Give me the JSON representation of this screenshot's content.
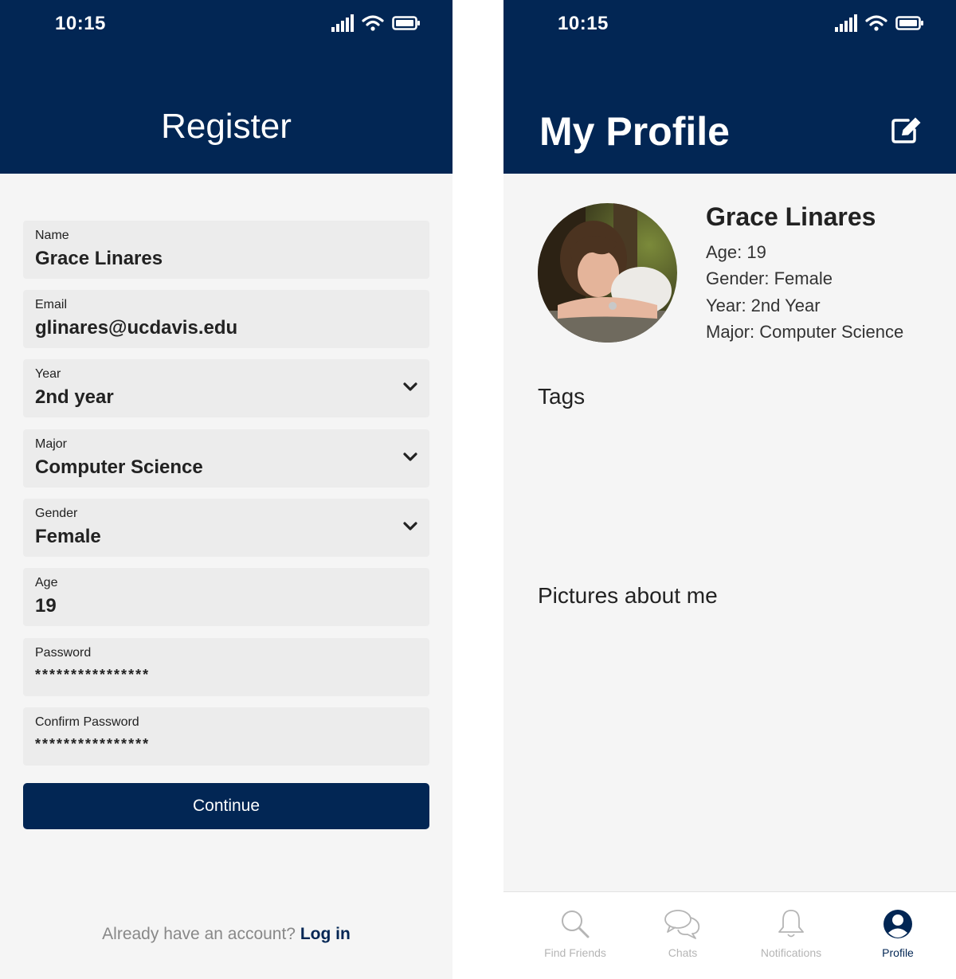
{
  "register": {
    "status_time": "10:15",
    "title": "Register",
    "fields": [
      {
        "label": "Name",
        "value": "Grace Linares"
      },
      {
        "label": "Email",
        "value": "glinares@ucdavis.edu"
      },
      {
        "label": "Year",
        "value": "2nd year"
      },
      {
        "label": "Major",
        "value": "Computer Science"
      },
      {
        "label": "Gender",
        "value": "Female"
      },
      {
        "label": "Age",
        "value": "19"
      },
      {
        "label": "Password",
        "value": "****************"
      },
      {
        "label": "Confirm Password",
        "value": "****************"
      }
    ],
    "continue_label": "Continue",
    "login_prompt": "Already have an account?",
    "login_link": "Log in"
  },
  "profile": {
    "status_time": "10:15",
    "title": "My Profile",
    "name": "Grace Linares",
    "age": "Age: 19",
    "gender": "Gender: Female",
    "year": "Year: 2nd Year",
    "major": "Major: Computer Science",
    "tags_heading": "Tags",
    "pictures_heading": "Pictures about me",
    "tabs": [
      {
        "label": "Find Friends",
        "icon": "search-icon"
      },
      {
        "label": "Chats",
        "icon": "chat-icon"
      },
      {
        "label": "Notifications",
        "icon": "bell-icon"
      },
      {
        "label": "Profile",
        "icon": "profile-icon",
        "active": true
      }
    ]
  },
  "colors": {
    "header": "#022654",
    "background": "#f5f5f5",
    "field": "#ececec",
    "tab_inactive": "#b5b5b5"
  }
}
